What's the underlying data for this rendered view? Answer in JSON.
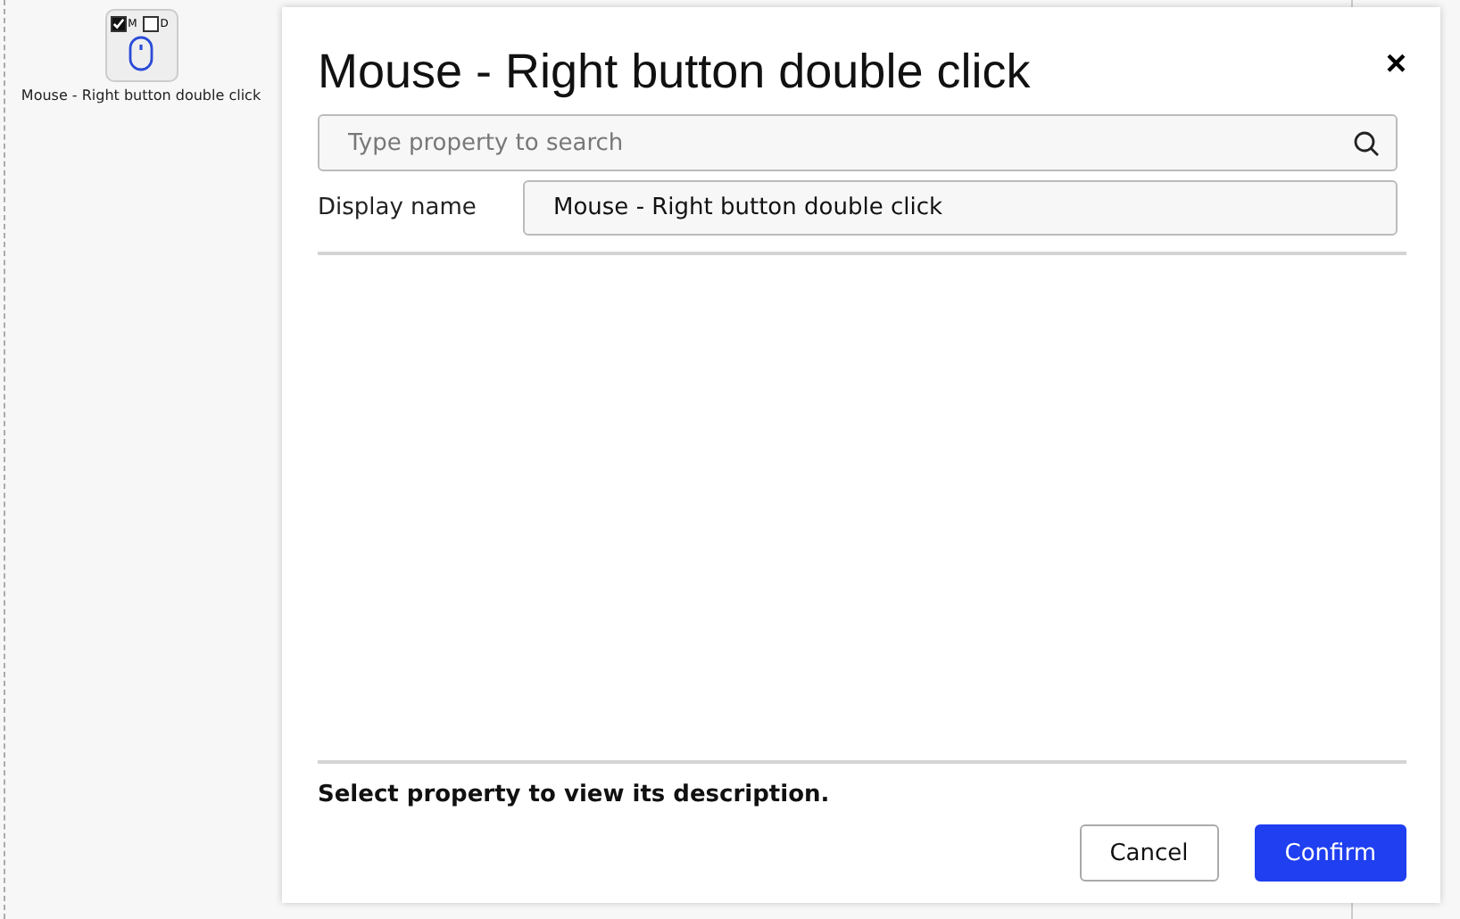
{
  "node": {
    "label": "Mouse - Right button double click",
    "flags": [
      {
        "label": "M",
        "checked": true
      },
      {
        "label": "D",
        "checked": false
      }
    ]
  },
  "dialog": {
    "title": "Mouse - Right button double click",
    "close": "×",
    "search": {
      "placeholder": "Type property to search"
    },
    "display_name": {
      "label": "Display name",
      "value": "Mouse - Right button double click"
    },
    "description": "Select property to view its description.",
    "buttons": [
      {
        "label": "Cancel",
        "kind": "secondary"
      },
      {
        "label": "Confirm",
        "kind": "primary"
      }
    ]
  }
}
